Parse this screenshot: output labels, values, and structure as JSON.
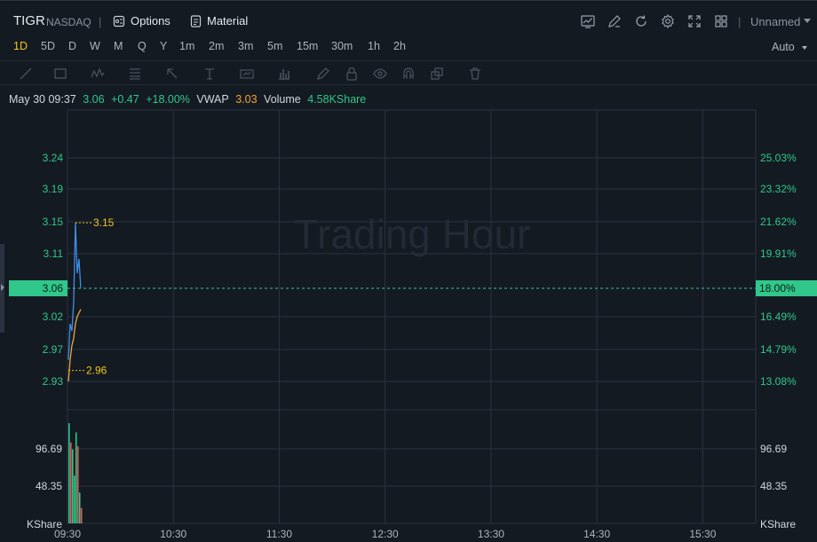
{
  "header": {
    "symbol": "TIGR",
    "exchange": "NASDAQ",
    "separator": "|",
    "options_label": "Options",
    "material_label": "Material",
    "layout_name": "Unnamed",
    "icons": [
      "chart-line-icon",
      "edit-icon",
      "refresh-icon",
      "settings-icon",
      "fullscreen-icon",
      "layout-grid-icon"
    ]
  },
  "periods": {
    "items": [
      "1D",
      "5D",
      "D",
      "W",
      "M",
      "Q",
      "Y",
      "1m",
      "2m",
      "3m",
      "5m",
      "15m",
      "30m",
      "1h",
      "2h"
    ],
    "active": "1D",
    "scale_mode": "Auto"
  },
  "drawing_tools": [
    "trend-line-icon",
    "rectangle-icon",
    "pattern-icon",
    "fib-icon",
    "arrow-icon",
    "text-tool-icon",
    "measure-icon",
    "indicator-icon",
    "pen-icon",
    "lock-icon",
    "eye-icon",
    "magnet-icon",
    "clone-icon",
    "trash-icon"
  ],
  "quote": {
    "datetime": "May 30 09:37",
    "price": "3.06",
    "change": "+0.47",
    "change_pct": "+18.00%",
    "vwap_label": "VWAP",
    "vwap": "3.03",
    "volume_label": "Volume",
    "volume": "4.58KShare"
  },
  "colors": {
    "background": "#141a22",
    "grid": "#2a3340",
    "up": "#2fc88a",
    "down": "#e05a5a",
    "price_line": "#3d8fe8",
    "vwap_line": "#f0a43a",
    "highlight": "#f0c419"
  },
  "chart_data": {
    "type": "line",
    "watermark": "Trading Hour",
    "price_axis": {
      "ticks": [
        "3.24",
        "3.19",
        "3.15",
        "3.11",
        "3.06",
        "3.02",
        "2.97",
        "2.93"
      ],
      "current": "3.06",
      "ylim": [
        2.93,
        3.24
      ]
    },
    "pct_axis": {
      "ticks": [
        "25.03%",
        "23.32%",
        "21.62%",
        "19.91%",
        "18.00%",
        "16.49%",
        "14.79%",
        "13.08%"
      ],
      "current": "18.00%"
    },
    "volume_axis": {
      "ticks": [
        "96.69",
        "48.35"
      ],
      "unit": "KShare"
    },
    "x_ticks": [
      "09:30",
      "10:30",
      "11:30",
      "12:30",
      "13:30",
      "14:30",
      "15:30"
    ],
    "x_range": [
      "09:30",
      "16:00"
    ],
    "high_label": "3.15",
    "low_label": "2.96",
    "series": [
      {
        "key": "price",
        "x": [
          "09:30",
          "09:31",
          "09:32",
          "09:33",
          "09:34",
          "09:35",
          "09:36",
          "09:37"
        ],
        "values": [
          2.96,
          3.01,
          3.0,
          3.04,
          3.15,
          3.08,
          3.1,
          3.06
        ]
      },
      {
        "key": "vwap",
        "x": [
          "09:30",
          "09:31",
          "09:32",
          "09:33",
          "09:34",
          "09:35",
          "09:36",
          "09:37"
        ],
        "values": [
          2.93,
          2.96,
          2.98,
          2.99,
          3.01,
          3.02,
          3.025,
          3.03
        ]
      }
    ],
    "volume": {
      "x": [
        "09:30",
        "09:31",
        "09:32",
        "09:33",
        "09:34",
        "09:35",
        "09:36",
        "09:37"
      ],
      "values": [
        130,
        105,
        96,
        62,
        118,
        100,
        40,
        20
      ],
      "direction": [
        "up",
        "down",
        "up",
        "up",
        "up",
        "down",
        "up",
        "down"
      ]
    }
  }
}
